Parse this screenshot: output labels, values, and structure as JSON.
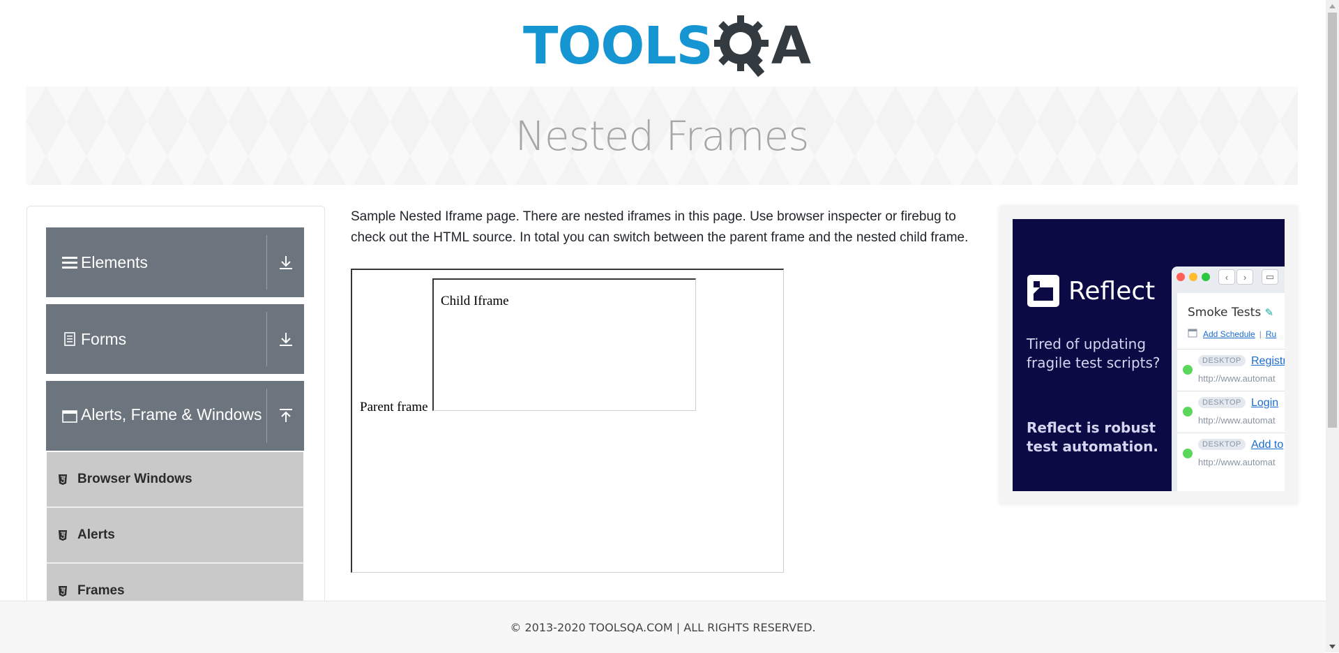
{
  "logo": {
    "text_tools": "TOOLS",
    "text_a": "A",
    "colors": {
      "tools": "#1695d3",
      "qa": "#333b41"
    }
  },
  "banner": {
    "title": "Nested Frames"
  },
  "sidebar": {
    "groups": [
      {
        "label": "Elements",
        "icon": "hamburger-icon",
        "toggle": "download-arrow-icon"
      },
      {
        "label": "Forms",
        "icon": "document-icon",
        "toggle": "download-arrow-icon"
      },
      {
        "label": "Alerts, Frame & Windows",
        "icon": "window-icon",
        "toggle": "upload-arrow-icon"
      }
    ],
    "items": [
      {
        "label": "Browser Windows",
        "icon": "html5-icon"
      },
      {
        "label": "Alerts",
        "icon": "html5-icon"
      },
      {
        "label": "Frames",
        "icon": "html5-icon"
      }
    ]
  },
  "main": {
    "description": "Sample Nested Iframe page. There are nested iframes in this page. Use browser inspecter or firebug to check out the HTML source. In total you can switch between the parent frame and the nested child frame.",
    "parent_frame_text": "Parent frame",
    "child_frame_text": "Child Iframe"
  },
  "ad": {
    "brand": "Reflect",
    "tagline": "Tired of updating fragile test scripts?",
    "subline": "Reflect is robust test automation.",
    "panel_title": "Smoke Tests",
    "schedule_link": "Add Schedule",
    "schedule_sep": "|",
    "schedule_more": "Ru",
    "rows": [
      {
        "badge": "DESKTOP",
        "link": "Registr",
        "url": "http://www.automat"
      },
      {
        "badge": "DESKTOP",
        "link": "Login",
        "url": "http://www.automat"
      },
      {
        "badge": "DESKTOP",
        "link": "Add to",
        "url": "http://www.automat"
      }
    ],
    "colors": {
      "background": "#0b0a45",
      "status_ok": "#5bd85b"
    }
  },
  "footer": {
    "text": "© 2013-2020 TOOLSQA.COM | ALL RIGHTS RESERVED."
  }
}
